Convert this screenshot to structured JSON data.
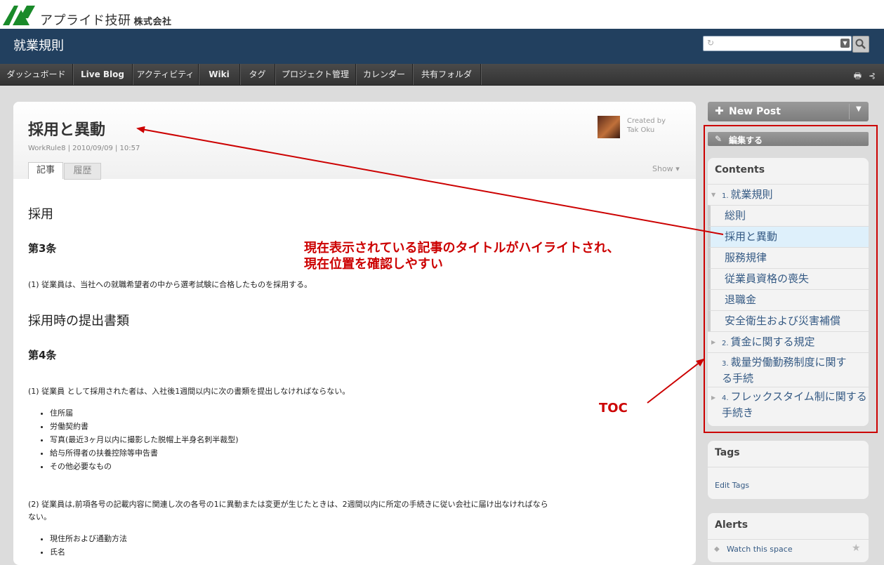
{
  "brand": {
    "company_name": "アプライド技研",
    "company_suffix": "株式会社"
  },
  "space": {
    "title": "就業規則"
  },
  "search": {
    "placeholder": ""
  },
  "nav": {
    "tabs": [
      "ダッシュボード",
      "Live Blog",
      "アクティビティ",
      "Wiki",
      "タグ",
      "プロジェクト管理",
      "カレンダー",
      "共有フォルダ"
    ]
  },
  "page": {
    "title": "採用と異動",
    "meta": "WorkRule8 | 2010/09/09 | 10:57",
    "created_by_label": "Created by",
    "author": "Tak Oku",
    "tabs": {
      "article": "記事",
      "history": "履歴"
    },
    "show_label": "Show"
  },
  "content": {
    "h1": "採用",
    "art3": "第3条",
    "p1": "(1) 従業員は、当社への就職希望者の中から選考試験に合格したものを採用する。",
    "h2": "採用時の提出書類",
    "art4": "第4条",
    "p2": "(1) 従業員 として採用された者は、入社後1週間以内に次の書類を提出しなければならない。",
    "list1": [
      "住所届",
      "労働契約書",
      "写真(最近3ヶ月以内に撮影した脱帽上半身名刺半裁型)",
      "給与所得者の扶養控除等申告書",
      "その他必要なもの"
    ],
    "p3a": "(2) 従業員は,前項各号の記載内容に関連し次の各号の1に異動または変更が生じたときは、2週間以内に所定の手続きに従い会社に届け出なければなら",
    "p3b": "ない。",
    "list2": [
      "現住所および通勤方法",
      "氏名"
    ]
  },
  "sidebar": {
    "new_post": "New Post",
    "edit": "編集する",
    "toc_title": "Contents",
    "toc": [
      {
        "num": "1.",
        "label": "就業規則"
      },
      {
        "label": "総則"
      },
      {
        "label": "採用と異動"
      },
      {
        "label": "服務規律"
      },
      {
        "label": "従業員資格の喪失"
      },
      {
        "label": "退職金"
      },
      {
        "label": "安全衛生および災害補償"
      },
      {
        "num": "2.",
        "label": "賃金に関する規定"
      },
      {
        "num": "3.",
        "label1": "裁量労働勤務制度に関す",
        "label2": "る手続"
      },
      {
        "num": "4.",
        "label1": "フレックスタイム制に関する",
        "label2": "手続き"
      }
    ],
    "tags_title": "Tags",
    "edit_tags": "Edit Tags",
    "alerts_title": "Alerts",
    "watch_space": "Watch this space"
  },
  "annotations": {
    "highlight_line1": "現在表示されている記事のタイトルがハイライトされ、",
    "highlight_line2": "現在位置を確認しやすい",
    "toc_label": "TOC",
    "color": "#cc0000"
  }
}
